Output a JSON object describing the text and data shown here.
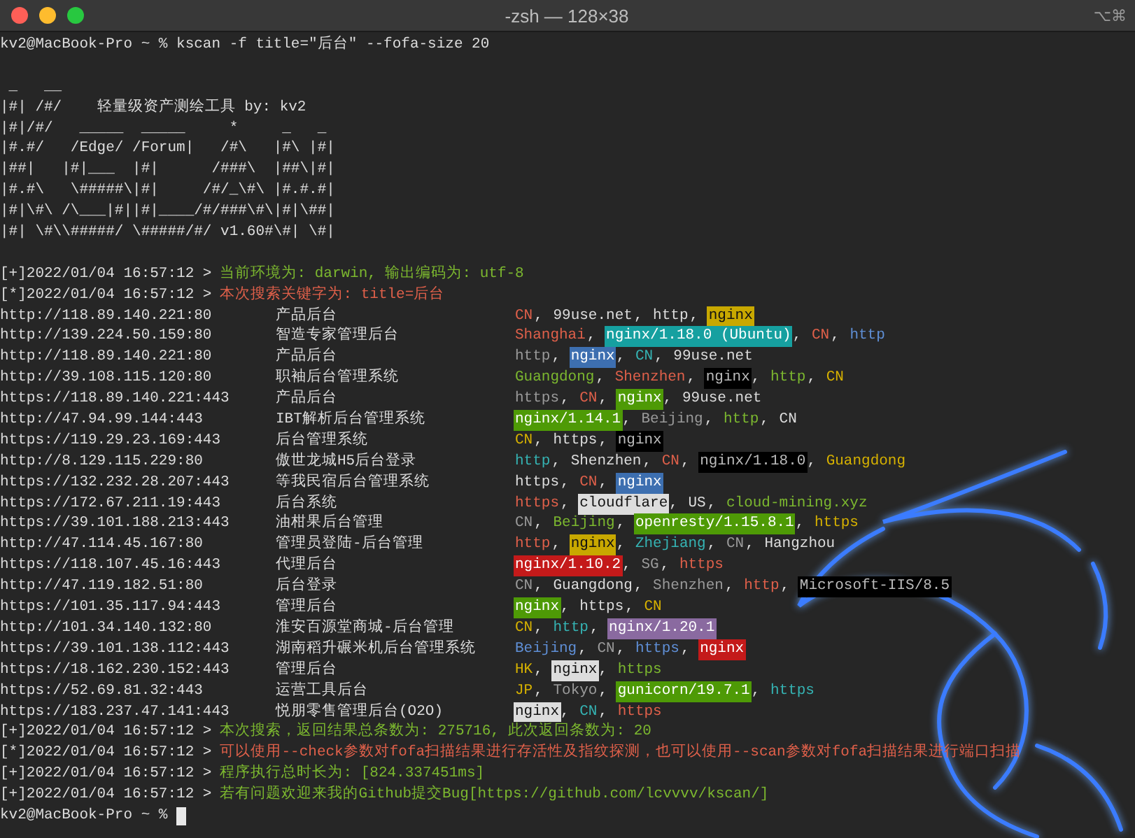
{
  "window": {
    "title": "-zsh — 128×38",
    "shortcut": "⌥⌘"
  },
  "command": "kv2@MacBook-Pro ~ % kscan -f title=\"后台\" --fofa-size 20",
  "banner": [
    " _   __",
    "|#| /#/    轻量级资产测绘工具 by: kv2",
    "|#|/#/   _____  _____     *     _   _",
    "|#.#/   /Edge/ /Forum|   /#\\   |#\\ |#|",
    "|##|   |#|___  |#|      /###\\  |##\\|#|",
    "|#.#\\   \\#####\\|#|     /#/_\\#\\ |#.#.#|",
    "|#|\\#\\ /\\___|#||#|____/#/###\\#\\|#|\\##|",
    "|#| \\#\\\\#####/ \\#####/#/ v1.60#\\#| \\#|"
  ],
  "log_top": [
    {
      "prefix": "[+]2022/01/04 16:57:12 >",
      "message": "当前环境为: darwin, 输出编码为: utf-8",
      "color": "#7cb82f"
    },
    {
      "prefix": "[*]2022/01/04 16:57:12 >",
      "message": "本次搜索关键字为: title=后台",
      "color": "#e0604a"
    }
  ],
  "results": [
    {
      "url": "http://118.89.140.221:80",
      "title": "产品后台",
      "tags": [
        {
          "kind": "plain",
          "text": "CN",
          "color": "#e0604a",
          "sep": ", "
        },
        {
          "kind": "plain",
          "text": "99use.net",
          "color": "#dddddd",
          "sep": ", "
        },
        {
          "kind": "plain",
          "text": "http",
          "color": "#dddddd",
          "sep": ", "
        },
        {
          "kind": "highlight",
          "text": "nginx",
          "color": "#c8a800"
        }
      ]
    },
    {
      "url": "http://139.224.50.159:80",
      "title": "智造专家管理后台",
      "tags": [
        {
          "kind": "plain",
          "text": "Shanghai",
          "color": "#e0604a",
          "sep": ", "
        },
        {
          "kind": "highlight",
          "text": "nginx/1.18.0 (Ubuntu)",
          "color": "#16a0a0",
          "sep": ", "
        },
        {
          "kind": "plain",
          "text": "CN",
          "color": "#e0604a",
          "sep": ", "
        },
        {
          "kind": "plain",
          "text": "http",
          "color": "#5f8fd6"
        }
      ]
    },
    {
      "url": "http://118.89.140.221:80",
      "title": "产品后台",
      "tags": [
        {
          "kind": "plain",
          "text": "http",
          "color": "#9a9a9a",
          "sep": ", "
        },
        {
          "kind": "highlight",
          "text": "nginx",
          "color": "#3d6fb0",
          "sep": ", "
        },
        {
          "kind": "plain",
          "text": "CN",
          "color": "#35b3b3",
          "sep": ", "
        },
        {
          "kind": "plain",
          "text": "99use.net",
          "color": "#dddddd"
        }
      ]
    },
    {
      "url": "http://39.108.115.120:80",
      "title": "职袖后台管理系统",
      "tags": [
        {
          "kind": "plain",
          "text": "Guangdong",
          "color": "#7cb82f",
          "sep": ", "
        },
        {
          "kind": "plain",
          "text": "Shenzhen",
          "color": "#e0604a",
          "sep": ", "
        },
        {
          "kind": "highlight",
          "text": "nginx",
          "color": "#000000",
          "sep": ", "
        },
        {
          "kind": "plain",
          "text": "http",
          "color": "#7cb82f",
          "sep": ", "
        },
        {
          "kind": "plain",
          "text": "CN",
          "color": "#d6b100"
        }
      ]
    },
    {
      "url": "https://118.89.140.221:443",
      "title": "产品后台",
      "tags": [
        {
          "kind": "plain",
          "text": "https",
          "color": "#9a9a9a",
          "sep": ", "
        },
        {
          "kind": "plain",
          "text": "CN",
          "color": "#e0604a",
          "sep": ", "
        },
        {
          "kind": "highlight",
          "text": "nginx",
          "color": "#4e9a06",
          "sep": ", "
        },
        {
          "kind": "plain",
          "text": "99use.net",
          "color": "#dddddd"
        }
      ]
    },
    {
      "url": "http://47.94.99.144:443",
      "title": "IBT解析后台管理系统",
      "tags": [
        {
          "kind": "highlight",
          "text": "nginx/1.14.1",
          "color": "#4e9a06",
          "sep": ", "
        },
        {
          "kind": "plain",
          "text": "Beijing",
          "color": "#9a9a9a",
          "sep": ", "
        },
        {
          "kind": "plain",
          "text": "http",
          "color": "#7cb82f",
          "sep": ", "
        },
        {
          "kind": "plain",
          "text": "CN",
          "color": "#dddddd"
        }
      ]
    },
    {
      "url": "https://119.29.23.169:443",
      "title": "后台管理系统",
      "tags": [
        {
          "kind": "plain",
          "text": "CN",
          "color": "#d6b100",
          "sep": ", "
        },
        {
          "kind": "plain",
          "text": "https",
          "color": "#dddddd",
          "sep": ", "
        },
        {
          "kind": "highlight",
          "text": "nginx",
          "color": "#000000"
        }
      ]
    },
    {
      "url": "http://8.129.115.229:80",
      "title": "傲世龙城H5后台登录",
      "tags": [
        {
          "kind": "plain",
          "text": "http",
          "color": "#35b3b3",
          "sep": ", "
        },
        {
          "kind": "plain",
          "text": "Shenzhen",
          "color": "#dddddd",
          "sep": ", "
        },
        {
          "kind": "plain",
          "text": "CN",
          "color": "#e0604a",
          "sep": ", "
        },
        {
          "kind": "highlight",
          "text": "nginx/1.18.0",
          "color": "#000000",
          "sep": ", "
        },
        {
          "kind": "plain",
          "text": "Guangdong",
          "color": "#d6b100"
        }
      ]
    },
    {
      "url": "https://132.232.28.207:443",
      "title": "等我民宿后台管理系统",
      "tags": [
        {
          "kind": "plain",
          "text": "https",
          "color": "#dddddd",
          "sep": ", "
        },
        {
          "kind": "plain",
          "text": "CN",
          "color": "#e0604a",
          "sep": ", "
        },
        {
          "kind": "highlight",
          "text": "nginx",
          "color": "#3d6fb0"
        }
      ]
    },
    {
      "url": "https://172.67.211.19:443",
      "title": "后台系统",
      "tags": [
        {
          "kind": "plain",
          "text": "https",
          "color": "#e0604a",
          "sep": ", "
        },
        {
          "kind": "highlight",
          "text": "cloudflare",
          "color": "#dddddd",
          "sep": ", "
        },
        {
          "kind": "plain",
          "text": "US",
          "color": "#dddddd",
          "sep": ", "
        },
        {
          "kind": "plain",
          "text": "cloud-mining.xyz",
          "color": "#7cb82f"
        }
      ]
    },
    {
      "url": "https://39.101.188.213:443",
      "title": "油柑果后台管理",
      "tags": [
        {
          "kind": "plain",
          "text": "CN",
          "color": "#9a9a9a",
          "sep": ", "
        },
        {
          "kind": "plain",
          "text": "Beijing",
          "color": "#7cb82f",
          "sep": ", "
        },
        {
          "kind": "highlight",
          "text": "openresty/1.15.8.1",
          "color": "#4e9a06",
          "sep": ", "
        },
        {
          "kind": "plain",
          "text": "https",
          "color": "#d6b100"
        }
      ]
    },
    {
      "url": "http://47.114.45.167:80",
      "title": "管理员登陆-后台管理",
      "tags": [
        {
          "kind": "plain",
          "text": "http",
          "color": "#e0604a",
          "sep": ", "
        },
        {
          "kind": "highlight",
          "text": "nginx",
          "color": "#c8a800",
          "sep": ", "
        },
        {
          "kind": "plain",
          "text": "Zhejiang",
          "color": "#35b3b3",
          "sep": ", "
        },
        {
          "kind": "plain",
          "text": "CN",
          "color": "#9a9a9a",
          "sep": ", "
        },
        {
          "kind": "plain",
          "text": "Hangzhou",
          "color": "#dddddd"
        }
      ]
    },
    {
      "url": "https://118.107.45.16:443",
      "title": "代理后台",
      "tags": [
        {
          "kind": "highlight",
          "text": "nginx/1.10.2",
          "color": "#c41a1a",
          "sep": ", "
        },
        {
          "kind": "plain",
          "text": "SG",
          "color": "#9a9a9a",
          "sep": ", "
        },
        {
          "kind": "plain",
          "text": "https",
          "color": "#e0604a"
        }
      ]
    },
    {
      "url": "http://47.119.182.51:80",
      "title": "后台登录",
      "tags": [
        {
          "kind": "plain",
          "text": "CN",
          "color": "#9a9a9a",
          "sep": ", "
        },
        {
          "kind": "plain",
          "text": "Guangdong",
          "color": "#dddddd",
          "sep": ", "
        },
        {
          "kind": "plain",
          "text": "Shenzhen",
          "color": "#9a9a9a",
          "sep": ", "
        },
        {
          "kind": "plain",
          "text": "http",
          "color": "#e0604a",
          "sep": ", "
        },
        {
          "kind": "highlight",
          "text": "Microsoft-IIS/8.5",
          "color": "#000000"
        }
      ]
    },
    {
      "url": "https://101.35.117.94:443",
      "title": "管理后台",
      "tags": [
        {
          "kind": "highlight",
          "text": "nginx",
          "color": "#4e9a06",
          "sep": ", "
        },
        {
          "kind": "plain",
          "text": "https",
          "color": "#dddddd",
          "sep": ", "
        },
        {
          "kind": "plain",
          "text": "CN",
          "color": "#d6b100"
        }
      ]
    },
    {
      "url": "http://101.34.140.132:80",
      "title": "淮安百源堂商城-后台管理",
      "tags": [
        {
          "kind": "plain",
          "text": "CN",
          "color": "#d6b100",
          "sep": ", "
        },
        {
          "kind": "plain",
          "text": "http",
          "color": "#35b3b3",
          "sep": ", "
        },
        {
          "kind": "highlight",
          "text": "nginx/1.20.1",
          "color": "#8a6aa0"
        }
      ]
    },
    {
      "url": "https://39.101.138.112:443",
      "title": "湖南稻升碾米机后台管理系统",
      "tags": [
        {
          "kind": "plain",
          "text": "Beijing",
          "color": "#5f8fd6",
          "sep": ", "
        },
        {
          "kind": "plain",
          "text": "CN",
          "color": "#9a9a9a",
          "sep": ", "
        },
        {
          "kind": "plain",
          "text": "https",
          "color": "#5f8fd6",
          "sep": ", "
        },
        {
          "kind": "highlight",
          "text": "nginx",
          "color": "#c41a1a"
        }
      ]
    },
    {
      "url": "https://18.162.230.152:443",
      "title": "管理后台",
      "tags": [
        {
          "kind": "plain",
          "text": "HK",
          "color": "#d6b100",
          "sep": ", "
        },
        {
          "kind": "highlight",
          "text": "nginx",
          "color": "#dddddd",
          "sep": ", "
        },
        {
          "kind": "plain",
          "text": "https",
          "color": "#7cb82f"
        }
      ]
    },
    {
      "url": "https://52.69.81.32:443",
      "title": "运营工具后台",
      "tags": [
        {
          "kind": "plain",
          "text": "JP",
          "color": "#d6b100",
          "sep": ", "
        },
        {
          "kind": "plain",
          "text": "Tokyo",
          "color": "#9a9a9a",
          "sep": ", "
        },
        {
          "kind": "highlight",
          "text": "gunicorn/19.7.1",
          "color": "#4e9a06",
          "sep": ", "
        },
        {
          "kind": "plain",
          "text": "https",
          "color": "#35b3b3"
        }
      ]
    },
    {
      "url": "https://183.237.47.141:443",
      "title": "悦朋零售管理后台(O2O)",
      "tags": [
        {
          "kind": "highlight",
          "text": "nginx",
          "color": "#dddddd",
          "sep": ", "
        },
        {
          "kind": "plain",
          "text": "CN",
          "color": "#35b3b3",
          "sep": ", "
        },
        {
          "kind": "plain",
          "text": "https",
          "color": "#e0604a"
        }
      ]
    }
  ],
  "log_bottom": [
    {
      "prefix": "[+]2022/01/04 16:57:12 >",
      "message": "本次搜索，返回结果总条数为: 275716, 此次返回条数为: 20",
      "color": "#7cb82f"
    },
    {
      "prefix": "[*]2022/01/04 16:57:12 >",
      "message": "可以使用--check参数对fofa扫描结果进行存活性及指纹探测，也可以使用--scan参数对fofa扫描结果进行端口扫描",
      "color": "#e0604a"
    },
    {
      "prefix": "[+]2022/01/04 16:57:12 >",
      "message": "程序执行总时长为: [824.337451ms]",
      "color": "#7cb82f"
    },
    {
      "prefix": "[+]2022/01/04 16:57:12 >",
      "message": "若有问题欢迎来我的Github提交Bug[https://github.com/lcvvvv/kscan/]",
      "color": "#7cb82f"
    }
  ],
  "prompt": "kv2@MacBook-Pro ~ %"
}
